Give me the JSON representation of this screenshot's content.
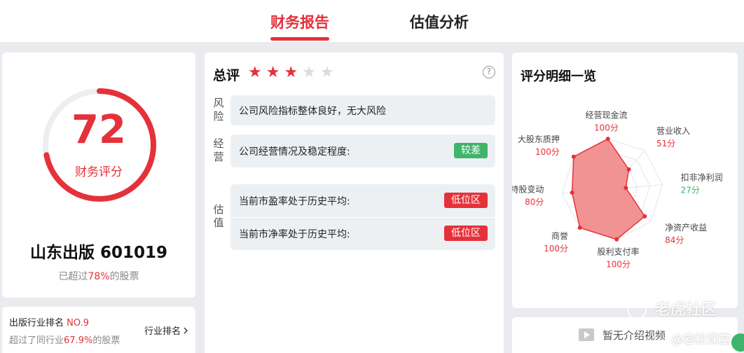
{
  "tabs": [
    {
      "label": "财务报告",
      "active": true
    },
    {
      "label": "估值分析",
      "active": false
    }
  ],
  "score": {
    "value": 72,
    "value_text": "72",
    "label": "财务评分",
    "company": "山东出版 601019",
    "exceed_prefix": "已超过",
    "exceed_pct": "78%",
    "exceed_suffix": "的股票"
  },
  "industry": {
    "rank_prefix": "出版行业排名 ",
    "rank_value": "NO.9",
    "exceed_prefix": "超过了同行业",
    "exceed_pct": "67.9%",
    "exceed_suffix": "的股票",
    "link_label": "行业排名"
  },
  "review": {
    "title": "总评",
    "stars_filled": 3,
    "stars_total": 5,
    "help_icon": "?",
    "risk": {
      "label": "风险",
      "text": "公司风险指标整体良好，无大风险"
    },
    "operation": {
      "label": "经营",
      "text": "公司经营情况及稳定程度:",
      "tag": "较差"
    },
    "valuation": {
      "label": "估值",
      "rows": [
        {
          "text": "当前市盈率处于历史平均:",
          "tag": "低位区"
        },
        {
          "text": "当前市净率处于历史平均:",
          "tag": "低位区"
        }
      ]
    }
  },
  "detail": {
    "title": "评分明细一览"
  },
  "chart_data": {
    "type": "radar",
    "title": "评分明细一览",
    "max": 100,
    "axes": [
      {
        "name": "营业收入",
        "value": 51,
        "display": "51分"
      },
      {
        "name": "扣非净利润",
        "value": 27,
        "display": "27分"
      },
      {
        "name": "净资产收益",
        "value": 84,
        "display": "84分"
      },
      {
        "name": "股利支付率",
        "value": 100,
        "display": "100分"
      },
      {
        "name": "商誉",
        "value": 100,
        "display": "100分"
      },
      {
        "name": "高管持股变动",
        "value": 80,
        "display": "80分"
      },
      {
        "name": "大股东质押",
        "value": 100,
        "display": "100分"
      },
      {
        "name": "经营现金流",
        "value": 100,
        "display": "100分"
      }
    ],
    "fill_color": "#f08080",
    "stroke_color": "#e5313a",
    "low_score_color": "#3fb46b"
  },
  "video": {
    "no_video_text": "暂无介绍视频"
  },
  "watermark": {
    "brand": "老虎社区",
    "author": "@岩松课堂"
  },
  "colors": {
    "accent": "#e5313a",
    "good": "#3fb46b"
  }
}
